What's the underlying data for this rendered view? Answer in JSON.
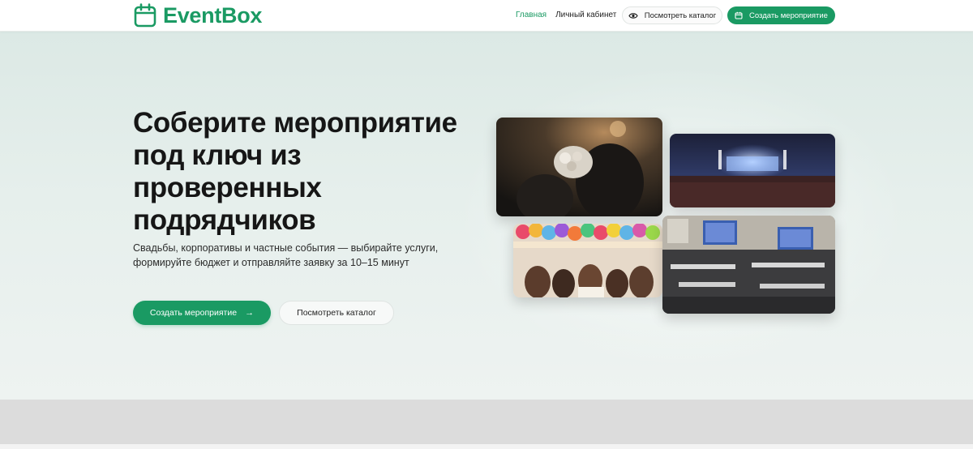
{
  "header": {
    "logo_text": "EventBox",
    "logo_icon": "calendar-icon",
    "nav": [
      {
        "label": "Главная",
        "active": true
      },
      {
        "label": "Личный кабинет",
        "active": false
      }
    ],
    "catalog_button": {
      "label": "Посмотреть каталог",
      "icon": "eye-icon"
    },
    "create_button": {
      "label": "Создать мероприятие",
      "icon": "calendar-icon"
    }
  },
  "hero": {
    "title": "Соберите мероприятие под ключ из проверенных подрядчиков",
    "subtitle": "Свадьбы, корпоративы и частные события — выбирайте услуги, формируйте бюджет и отправляйте заявку за 10–15 минут",
    "primary_cta": {
      "label": "Создать мероприятие",
      "icon": "arrow-right-icon"
    },
    "secondary_cta": {
      "label": "Посмотреть каталог"
    },
    "photos": [
      "wedding-photo",
      "concert-photo",
      "birthday-party-photo",
      "conference-photo"
    ]
  },
  "colors": {
    "brand": "#1a9a63",
    "hero_background": "#e3eeea",
    "footer_band": "#dcdcdc",
    "text": "#161616"
  }
}
